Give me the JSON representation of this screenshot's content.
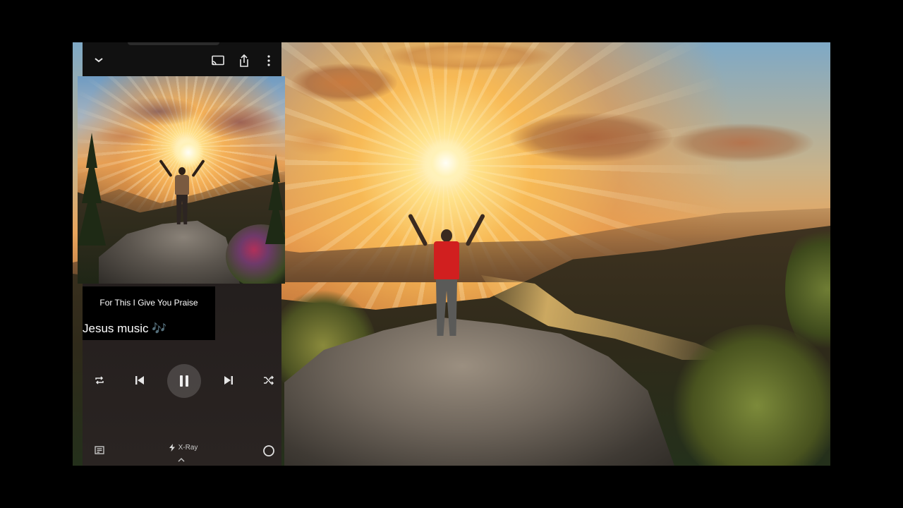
{
  "video": {
    "scene_description_icon": "sunrise-scene"
  },
  "player": {
    "topbar": {
      "collapse_icon": "chevron-down-icon",
      "cast_icon": "cast-icon",
      "share_icon": "share-icon",
      "more_icon": "more-vert-icon"
    },
    "track": {
      "title": "For This I Give You Praise",
      "channel": "Jesus music 🎶"
    },
    "controls": {
      "repeat_icon": "repeat-icon",
      "previous_icon": "skip-previous-icon",
      "pause_icon": "pause-icon",
      "next_icon": "skip-next-icon",
      "shuffle_icon": "shuffle-icon"
    },
    "bottom": {
      "queue_icon": "queue-icon",
      "xray_label": "X-Ray",
      "xray_icon": "bolt-icon",
      "expand_icon": "chevron-up-icon",
      "circle_icon": "circle-icon"
    }
  },
  "colors": {
    "panel_bg": "#1a1616",
    "topbar_bg": "#111111",
    "shirt_red": "#d11f1f",
    "sun_glow": "#ffe28a"
  }
}
